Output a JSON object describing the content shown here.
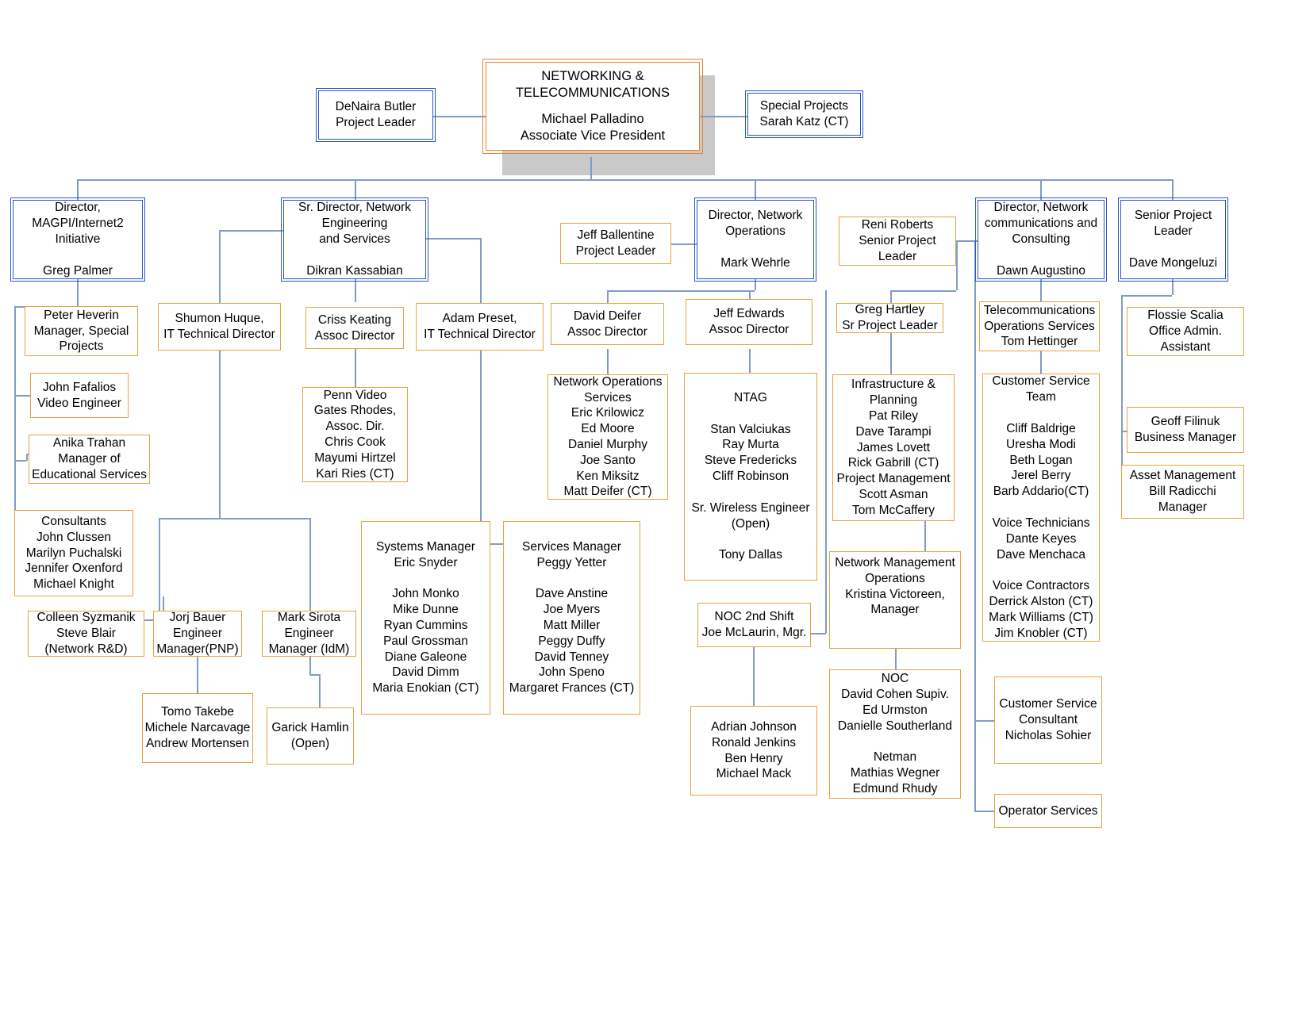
{
  "chart": {
    "title": "Networking & Telecommunications Organizational Chart",
    "colors": {
      "orange_border": "#e8a33d",
      "root_border": "#e8822d",
      "blue_border": "#2b56c4",
      "connector": "#7f9cc4",
      "shadow": "#c9c9c9",
      "background": "#ffffff",
      "text": "#000000"
    }
  },
  "root": {
    "department": "NETWORKING &\nTELECOMMUNICATIONS",
    "person": "Michael Palladino\nAssociate Vice President"
  },
  "top_support": {
    "left": "DeNaira Butler\nProject Leader",
    "right": "Special Projects\nSarah Katz (CT)"
  },
  "directors": {
    "magpi": "Director,\nMAGPI/Internet2\nInitiative\n\nGreg Palmer",
    "network_engineering": "Sr. Director, Network\nEngineering\nand Services\n\nDikran Kassabian",
    "network_operations": "Director, Network\nOperations\n\nMark Wehrle",
    "network_communications": "Director, Network\ncommunications and\nConsulting\n\nDawn Augustino",
    "senior_project_leader": "Senior Project\nLeader\n\nDave Mongeluzi"
  },
  "project_leaders": {
    "jeff_ballentine": "Jeff Ballentine\nProject Leader",
    "reni_roberts": "Reni Roberts\nSenior Project\nLeader"
  },
  "magpi_branch": {
    "peter_heverin": "Peter Heverin\nManager, Special\nProjects",
    "john_fafalios": "John Fafalios\nVideo Engineer",
    "anika_trahan": "Anika Trahan\nManager of\nEducational Services",
    "consultants": "Consultants\nJohn Clussen\nMarilyn Puchalski\nJennifer Oxenford\nMichael Knight",
    "network_rd": "Colleen  Syzmanik\nSteve Blair\n(Network R&D)"
  },
  "engineering_branch": {
    "shumon_huque": "Shumon Huque,\nIT Technical Director",
    "criss_keating": "Criss Keating\nAssoc Director",
    "adam_preset": "Adam Preset,\nIT Technical Director",
    "penn_video": "Penn Video\nGates Rhodes,\nAssoc. Dir.\nChris Cook\nMayumi Hirtzel\nKari Ries (CT)",
    "jorj_bauer": "Jorj Bauer\nEngineer\nManager(PNP)",
    "mark_sirota": "Mark Sirota\nEngineer\nManager (IdM)",
    "pnp_team": "Tomo Takebe\nMichele Narcavage\nAndrew Mortensen",
    "idm_team": "Garick  Hamlin\n(Open)",
    "systems_manager": "Systems Manager\nEric Snyder\n\nJohn Monko\nMike Dunne\nRyan Cummins\nPaul Grossman\nDiane Galeone\nDavid Dimm\nMaria Enokian (CT)",
    "services_manager": "Services Manager\nPeggy Yetter\n\nDave Anstine\nJoe Myers\nMatt Miller\nPeggy Duffy\nDavid Tenney\nJohn Speno\nMargaret Frances (CT)"
  },
  "operations_branch": {
    "david_deifer": "David Deifer\nAssoc Director",
    "jeff_edwards": "Jeff Edwards\nAssoc Director",
    "network_operations_services": "Network Operations\nServices\nEric Krilowicz\nEd Moore\nDaniel Murphy\nJoe Santo\nKen Miksitz\nMatt Deifer (CT)",
    "ntag": "NTAG\n\nStan Valciukas\nRay Murta\nSteve Fredericks\nCliff Robinson\n\nSr. Wireless Engineer\n(Open)\n\nTony Dallas",
    "noc_2nd_shift": "NOC 2nd Shift\nJoe McLaurin, Mgr.",
    "noc_2nd_shift_team": "Adrian Johnson\nRonald Jenkins\nBen Henry\nMichael Mack"
  },
  "hartley_branch": {
    "greg_hartley": "Greg Hartley\nSr Project Leader",
    "infrastructure_planning": "Infrastructure &\nPlanning\nPat Riley\nDave Tarampi\nJames Lovett\nRick Gabrill (CT)\nProject Management\nScott Asman\nTom McCaffery",
    "network_management_operations": "Network Management\nOperations\nKristina Victoreen,\nManager",
    "noc": "NOC\nDavid Cohen Supiv.\nEd Urmston\nDanielle Southerland\n\nNetman\nMathias Wegner\nEdmund Rhudy"
  },
  "communications_branch": {
    "telecom_operations": "Telecommunications\nOperations Services\nTom Hettinger",
    "customer_service_team": "Customer Service\nTeam\n\nCliff Baldrige\nUresha Modi\nBeth Logan\nJerel Berry\nBarb Addario(CT)\n\nVoice Technicians\nDante Keyes\nDave Menchaca\n\nVoice Contractors\nDerrick Alston (CT)\nMark Williams (CT)\nJim Knobler (CT)",
    "customer_service_consultant": "Customer Service\nConsultant\nNicholas Sohier",
    "operator_services": "Operator Services"
  },
  "mongeluzi_branch": {
    "flossie_scalia": "Flossie Scalia\nOffice Admin.\nAssistant",
    "geoff_filinuk": "Geoff Filinuk\nBusiness Manager",
    "asset_management": "Asset Management\nBill Radicchi\nManager"
  }
}
